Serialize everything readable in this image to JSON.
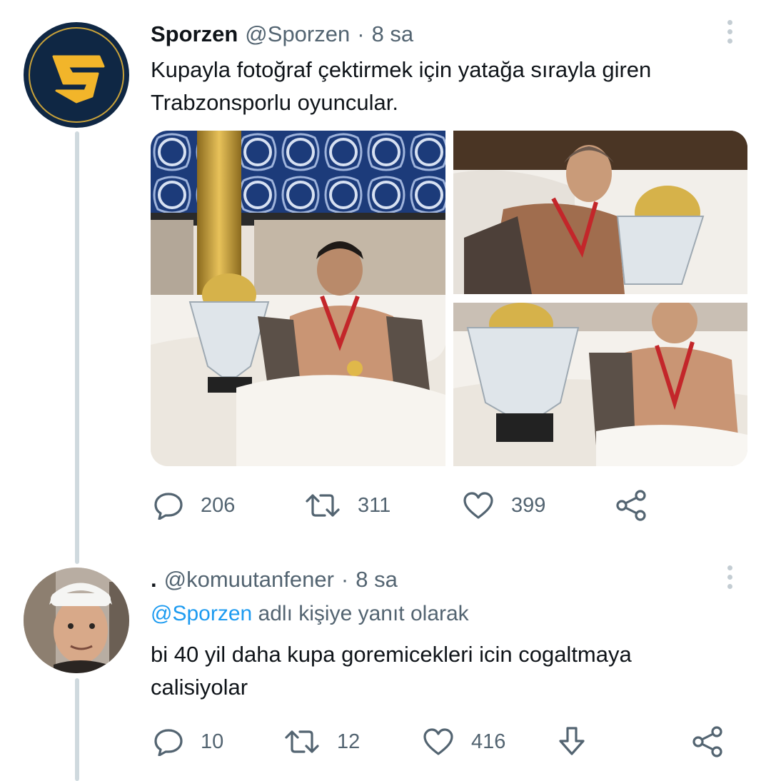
{
  "tweet": {
    "display_name": "Sporzen",
    "handle": "@Sporzen",
    "separator": "·",
    "time": "8 sa",
    "text_line1": "Kupayla fotoğraf çektirmek için yatağa sırayla giren",
    "text_line2": "Trabzonsporlu oyuncular.",
    "avatar_icon": "sporzen-logo-icon",
    "media": [
      "photo-player-bed-trophy",
      "photo-player-holding-trophy",
      "photo-player-trophy-in-bed"
    ],
    "actions": {
      "replies": "206",
      "retweets": "311",
      "likes": "399"
    }
  },
  "reply": {
    "display_name": ".",
    "handle": "@komuutanfener",
    "separator": "·",
    "time": "8 sa",
    "replying_to_handle": "@Sporzen",
    "replying_to_suffix": "adlı kişiye yanıt olarak",
    "text_line1": "bi 40 yil daha kupa goremicekleri icin cogaltmaya",
    "text_line2": "calisiyolar",
    "actions": {
      "replies": "10",
      "retweets": "12",
      "likes": "416"
    }
  },
  "colors": {
    "accent": "#1d9bf0",
    "muted": "#536471",
    "thread_line": "#cfd9de",
    "logo_navy": "#0f2744",
    "logo_gold": "#f2b52a"
  }
}
